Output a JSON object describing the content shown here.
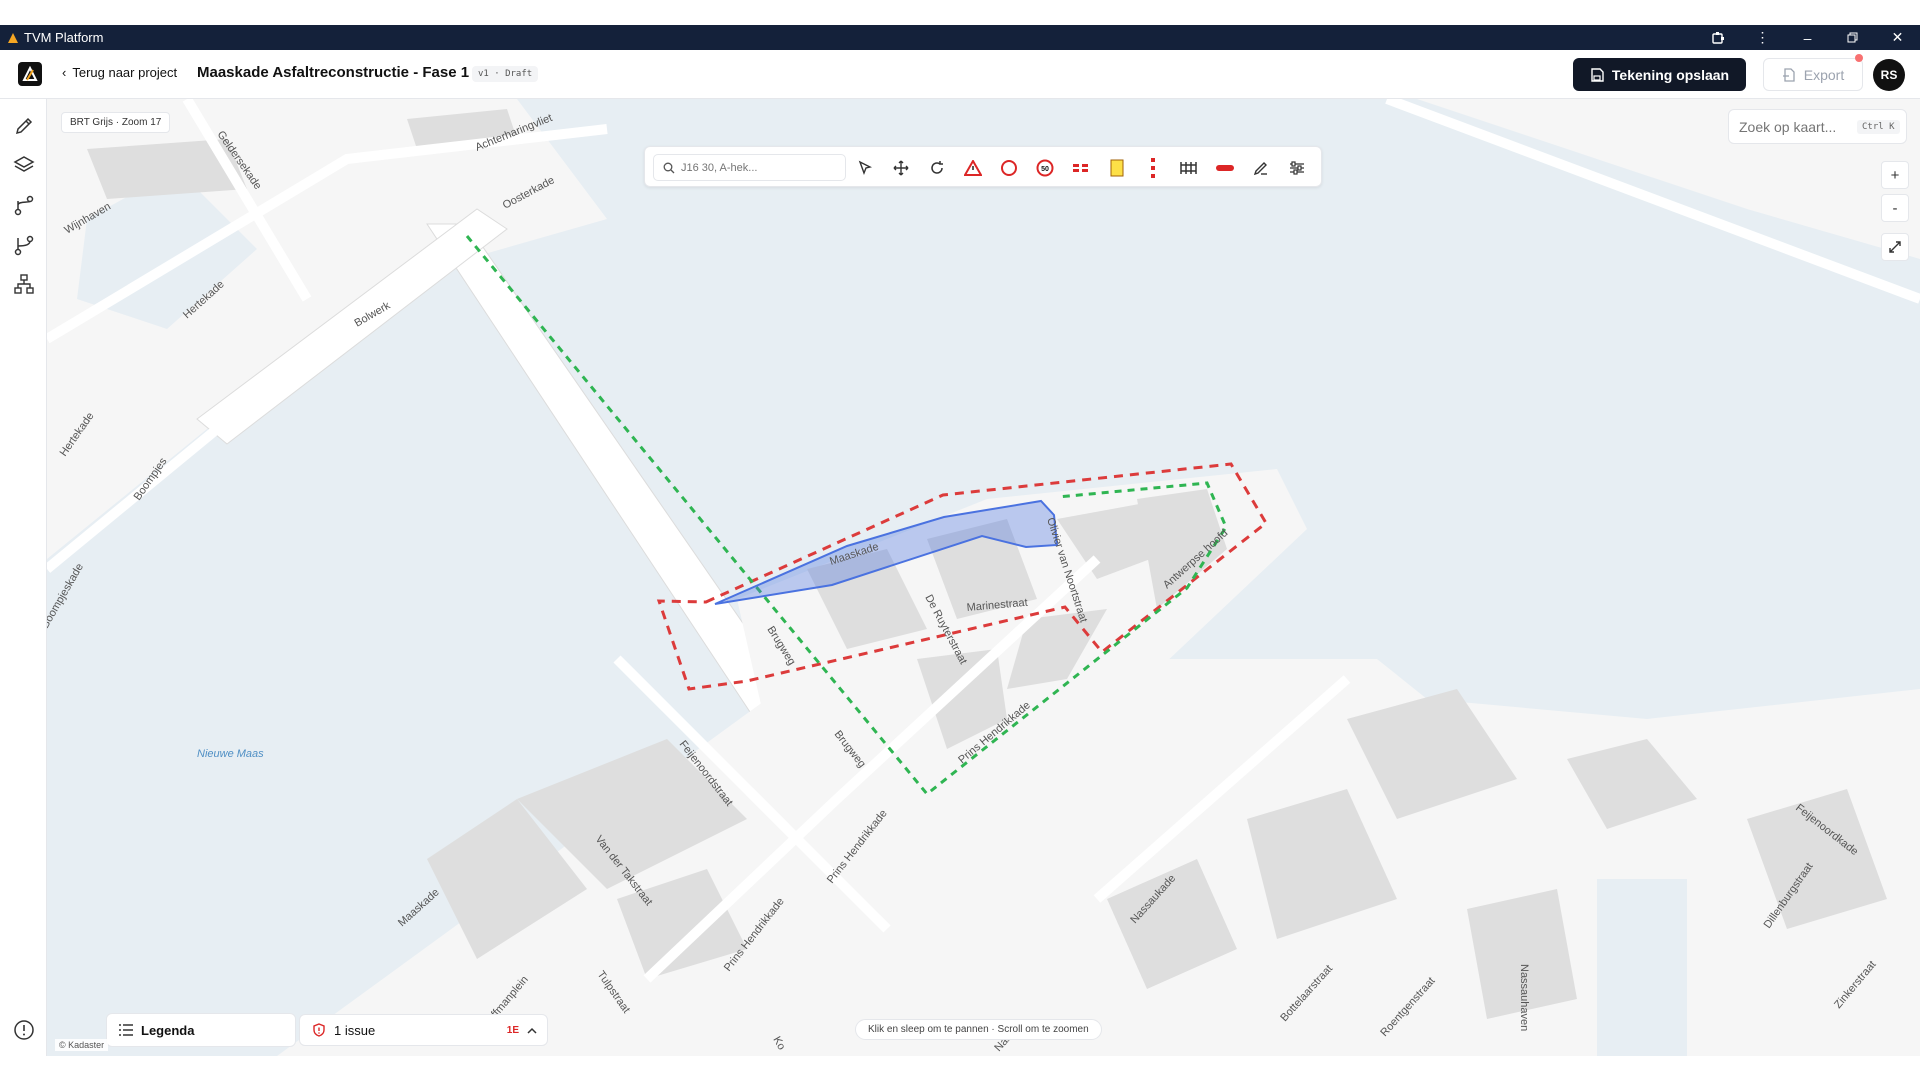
{
  "window": {
    "title": "TVM Platform"
  },
  "header": {
    "back_label": "Terug naar project",
    "doc_title": "Maaskade Asfaltreconstructie - Fase 1",
    "version_badge": "v1 · Draft",
    "save_label": "Tekening opslaan",
    "export_label": "Export",
    "avatar_initials": "RS"
  },
  "sidebar": {
    "items": [
      {
        "icon": "pencil-icon"
      },
      {
        "icon": "layers-icon"
      },
      {
        "icon": "route-icon"
      },
      {
        "icon": "route-alt-icon"
      },
      {
        "icon": "hierarchy-icon"
      }
    ],
    "help_icon": "info-icon"
  },
  "map": {
    "basemap_label": "BRT Grijs · Zoom 17",
    "toolbar": {
      "search_placeholder": "J16 30, A-hek...",
      "tools": [
        "select-icon",
        "move-icon",
        "rotate-icon",
        "warning-sign-icon",
        "circle-sign-icon",
        "speed-50-icon",
        "barrier-dashed-icon",
        "yellow-box-icon",
        "red-pole-icon",
        "fence-icon",
        "red-bar-icon",
        "pen-icon",
        "sliders-icon"
      ]
    },
    "search_placeholder": "Zoek op kaart...",
    "search_shortcut": "Ctrl K",
    "zoom_in": "+",
    "zoom_out": "-",
    "street_labels": {
      "geldersekade": "Geldersekade",
      "achterharingvliet": "Achterharingvliet",
      "oosterkade": "Oosterkade",
      "wijnhaven": "Wijnhaven",
      "hertekade1": "Hertekade",
      "bolwerk": "Bolwerk",
      "hertekade2": "Hertekade",
      "boompjes": "Boompjes",
      "boompjeskade": "Boompjeskade",
      "maaskade": "Maaskade",
      "brugweg1": "Brugweg",
      "brugweg2": "Brugweg",
      "de_ruyterstraat": "De Ruyterstraat",
      "marinestraat": "Marinestraat",
      "olivier": "Olivier van Noortstraat",
      "antwerpse": "Antwerpse hoofd",
      "prins_hendrikkade1": "Prins Hendrikkade",
      "prins_hendrikkade2": "Prins Hendrikkade",
      "prins_hendrikkade3": "Prins Hendrikkade",
      "feijenoordstraat": "Feijenoordstraat",
      "van_der_takstraat": "Van der Takstraat",
      "maaskade2": "Maaskade",
      "hoffmanplein": "Hoffmanplein",
      "tulpstraat": "Tulpstraat",
      "nassaukade": "Nassaukade",
      "bottelaarstraat": "Bottelaarstraat",
      "roentgenstraat": "Roentgenstraat",
      "nassauhaven": "Nassauhaven",
      "feijenoordkade": "Feijenoordkade",
      "dillenburgstraat": "Dillenburgstraat",
      "zinkerstraat": "Zinkerstraat",
      "nieuwe_maas": "Nieuwe Maas",
      "ko": "Ko",
      "nas": "Nas"
    },
    "legend_label": "Legenda",
    "issues_label": "1 issue",
    "issues_count": "1E",
    "hint": "Klik en sleep om te pannen · Scroll om te zoomen",
    "attribution": "© Kadaster"
  },
  "colors": {
    "titlebar": "#14213a",
    "water": "#e7eef3",
    "land": "#f6f6f6",
    "zone_red": "#dc3b3b",
    "route_green": "#2fb552",
    "selection_blue": "#4a72e0"
  }
}
